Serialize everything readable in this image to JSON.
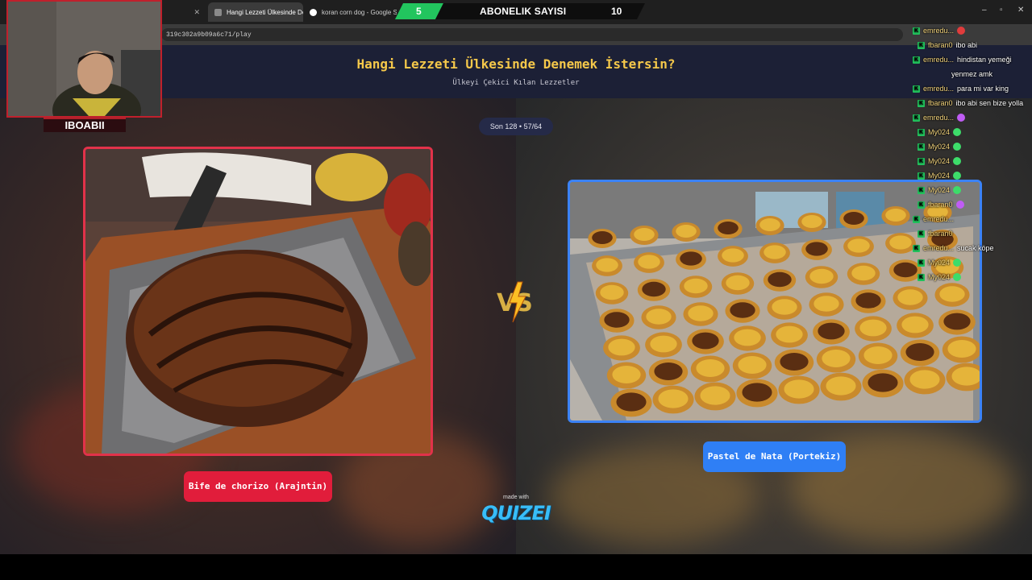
{
  "browser": {
    "tabs": [
      {
        "label": "",
        "active": false
      },
      {
        "label": "Hangi Lezzeti Ülkesinde Denem",
        "active": true
      },
      {
        "label": "koran corn dog - Google Sear",
        "active": false
      }
    ],
    "url": "319c302a9b09a6c71/play",
    "window_controls": [
      "–",
      "▫",
      "✕"
    ]
  },
  "subscriber_bar": {
    "current": "5",
    "label": "ABONELIK SAYISI",
    "target": "10"
  },
  "webcam": {
    "name": "IBOABII"
  },
  "page": {
    "title": "Hangi Lezzeti Ülkesinde Denemek İstersin?",
    "subtitle": "Ülkeyi Çekici Kılan Lezzetler",
    "round": "Son 128 • 57/64",
    "left_option": "Bife de chorizo (Arajntin)",
    "right_option": "Pastel de Nata (Portekiz)",
    "made_with": "made with",
    "brand": "QUIZEI"
  },
  "chat": [
    {
      "user": "emredu...",
      "msg": "",
      "emote": "red"
    },
    {
      "user": "fbaran0",
      "msg": "ibo abi",
      "emote": ""
    },
    {
      "user": "emredu...",
      "msg": "hindistan yemeği",
      "emote": ""
    },
    {
      "user": "",
      "msg": "yenmez amk",
      "emote": ""
    },
    {
      "user": "emredu...",
      "msg": "para mi var king",
      "emote": ""
    },
    {
      "user": "fbaran0",
      "msg": "ibo abi sen bize yolla",
      "emote": ""
    },
    {
      "user": "emredu...",
      "msg": "",
      "emote": "purple"
    },
    {
      "user": "My024",
      "msg": "",
      "emote": "green"
    },
    {
      "user": "My024",
      "msg": "",
      "emote": "green"
    },
    {
      "user": "My024",
      "msg": "",
      "emote": "green"
    },
    {
      "user": "My024",
      "msg": "",
      "emote": "green"
    },
    {
      "user": "My024",
      "msg": "",
      "emote": "green"
    },
    {
      "user": "fbaran0",
      "msg": "",
      "emote": "purple"
    },
    {
      "user": "emredu...",
      "msg": "",
      "emote": ""
    },
    {
      "user": "fbaran0",
      "msg": "",
      "emote": ""
    },
    {
      "user": "emredu...",
      "msg": "sucak köpe",
      "emote": ""
    },
    {
      "user": "My024",
      "msg": "",
      "emote": "green"
    },
    {
      "user": "My024",
      "msg": "",
      "emote": "green"
    }
  ],
  "colors": {
    "left_accent": "#e11d3b",
    "right_accent": "#2f7ff5",
    "title": "#f5c84a",
    "header_bg": "#1c2036"
  }
}
